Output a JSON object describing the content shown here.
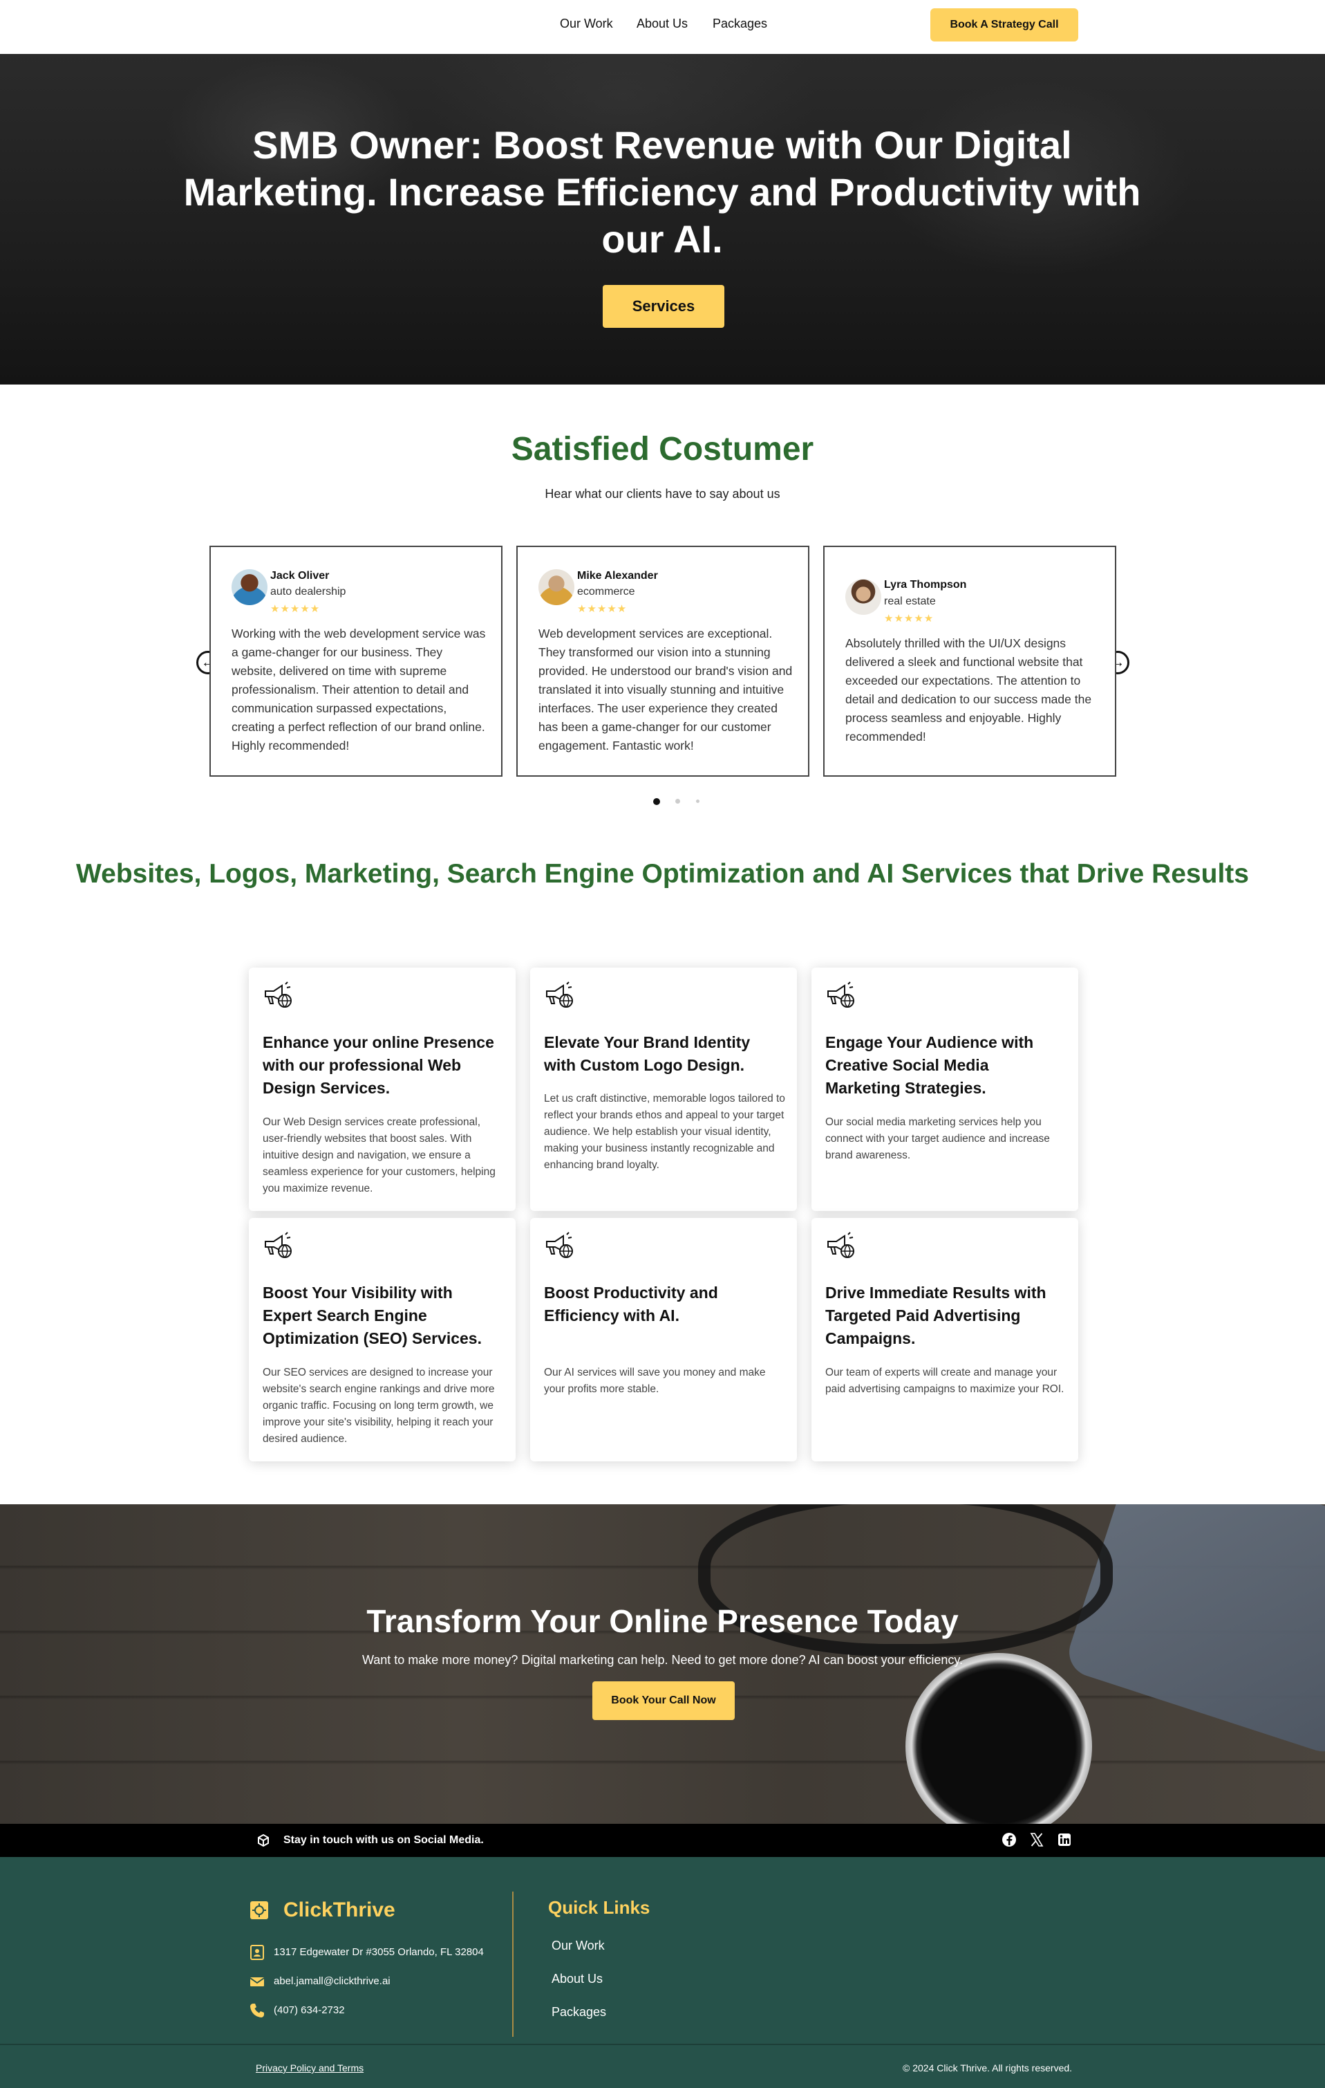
{
  "nav": {
    "links": [
      "Our Work",
      "About Us",
      "Packages"
    ],
    "cta": "Book A Strategy Call"
  },
  "hero": {
    "title": "SMB Owner: Boost Revenue with Our Digital Marketing. Increase Efficiency and Productivity with our AI.",
    "button": "Services"
  },
  "testimonials": {
    "heading": "Satisfied Costumer",
    "subheading": "Hear what our clients have to say about us",
    "stars": "★★★★★",
    "cards": [
      {
        "name": "Jack Oliver",
        "role": "auto dealership",
        "text": "Working with the web development service was a game-changer for our business. They website, delivered on time with supreme professionalism. Their attention to detail and communication surpassed expectations, creating a perfect reflection of our brand online. Highly recommended!"
      },
      {
        "name": "Mike Alexander",
        "role": "ecommerce",
        "text": "Web development services are exceptional. They transformed our vision into a stunning provided. He understood our brand's vision and translated it into visually stunning and intuitive interfaces. The user experience they created has been a game-changer for our customer engagement. Fantastic work!"
      },
      {
        "name": "Lyra Thompson",
        "role": "real estate",
        "text": "Absolutely thrilled with the UI/UX designs delivered a sleek and functional website that exceeded our expectations. The attention to detail and dedication to our success made the process seamless and enjoyable. Highly recommended!"
      }
    ],
    "prev_icon": "arrow-left-circle-icon",
    "next_icon": "arrow-right-circle-icon",
    "active_page": 1,
    "page_count": 3
  },
  "services": {
    "heading": "Websites, Logos, Marketing, Search Engine Optimization and AI Services that Drive Results",
    "icon": "megaphone-globe-icon",
    "cards": [
      {
        "title": "Enhance your online Presence with our professional Web Design Services.",
        "desc": "Our Web Design services create professional, user-friendly websites that boost sales. With intuitive design and navigation, we ensure a seamless experience for your customers, helping you maximize revenue."
      },
      {
        "title": "Elevate Your Brand Identity with Custom Logo Design.",
        "desc": "Let us craft distinctive, memorable logos tailored to reflect your brands ethos and appeal to your target audience. We help establish your visual identity, making your business instantly recognizable and enhancing brand loyalty."
      },
      {
        "title": "Engage Your Audience with Creative Social Media Marketing Strategies.",
        "desc": "Our social media marketing services help you connect with your target audience and increase brand awareness."
      },
      {
        "title": "Boost Your Visibility with Expert Search Engine Optimization (SEO) Services.",
        "desc": "Our SEO services are designed to increase your website's search engine rankings and drive more organic traffic. Focusing on long term growth, we improve your site's visibility, helping it reach your desired audience."
      },
      {
        "title": "Boost Productivity and Efficiency with AI.",
        "desc": "Our AI services will save you money and make your profits more stable."
      },
      {
        "title": "Drive Immediate Results with Targeted Paid Advertising Campaigns.",
        "desc": "Our team of experts will create and manage your paid advertising campaigns to maximize your ROI."
      }
    ]
  },
  "cta": {
    "title": "Transform Your Online Presence Today",
    "subtitle": "Want to make more money? Digital marketing can help. Need to get more done? AI can boost your efficiency.",
    "button": "Book Your Call Now"
  },
  "social": {
    "text": "Stay in touch with us on Social Media.",
    "icons": [
      "facebook-icon",
      "x-twitter-icon",
      "linkedin-icon"
    ]
  },
  "footer": {
    "brand": "ClickThrive",
    "address": "1317 Edgewater Dr #3055 Orlando, FL 32804",
    "email": "abel.jamall@clickthrive.ai",
    "phone": "(407) 634-2732",
    "quick_links_title": "Quick Links",
    "quick_links": [
      "Our Work",
      "About Us",
      "Packages"
    ],
    "policy": "Privacy Policy and Terms",
    "copyright": "© 2024 Click Thrive. All rights reserved."
  },
  "colors": {
    "accent_yellow": "#fed25f",
    "heading_green": "#2c6b2f",
    "footer_green": "#26524a"
  }
}
